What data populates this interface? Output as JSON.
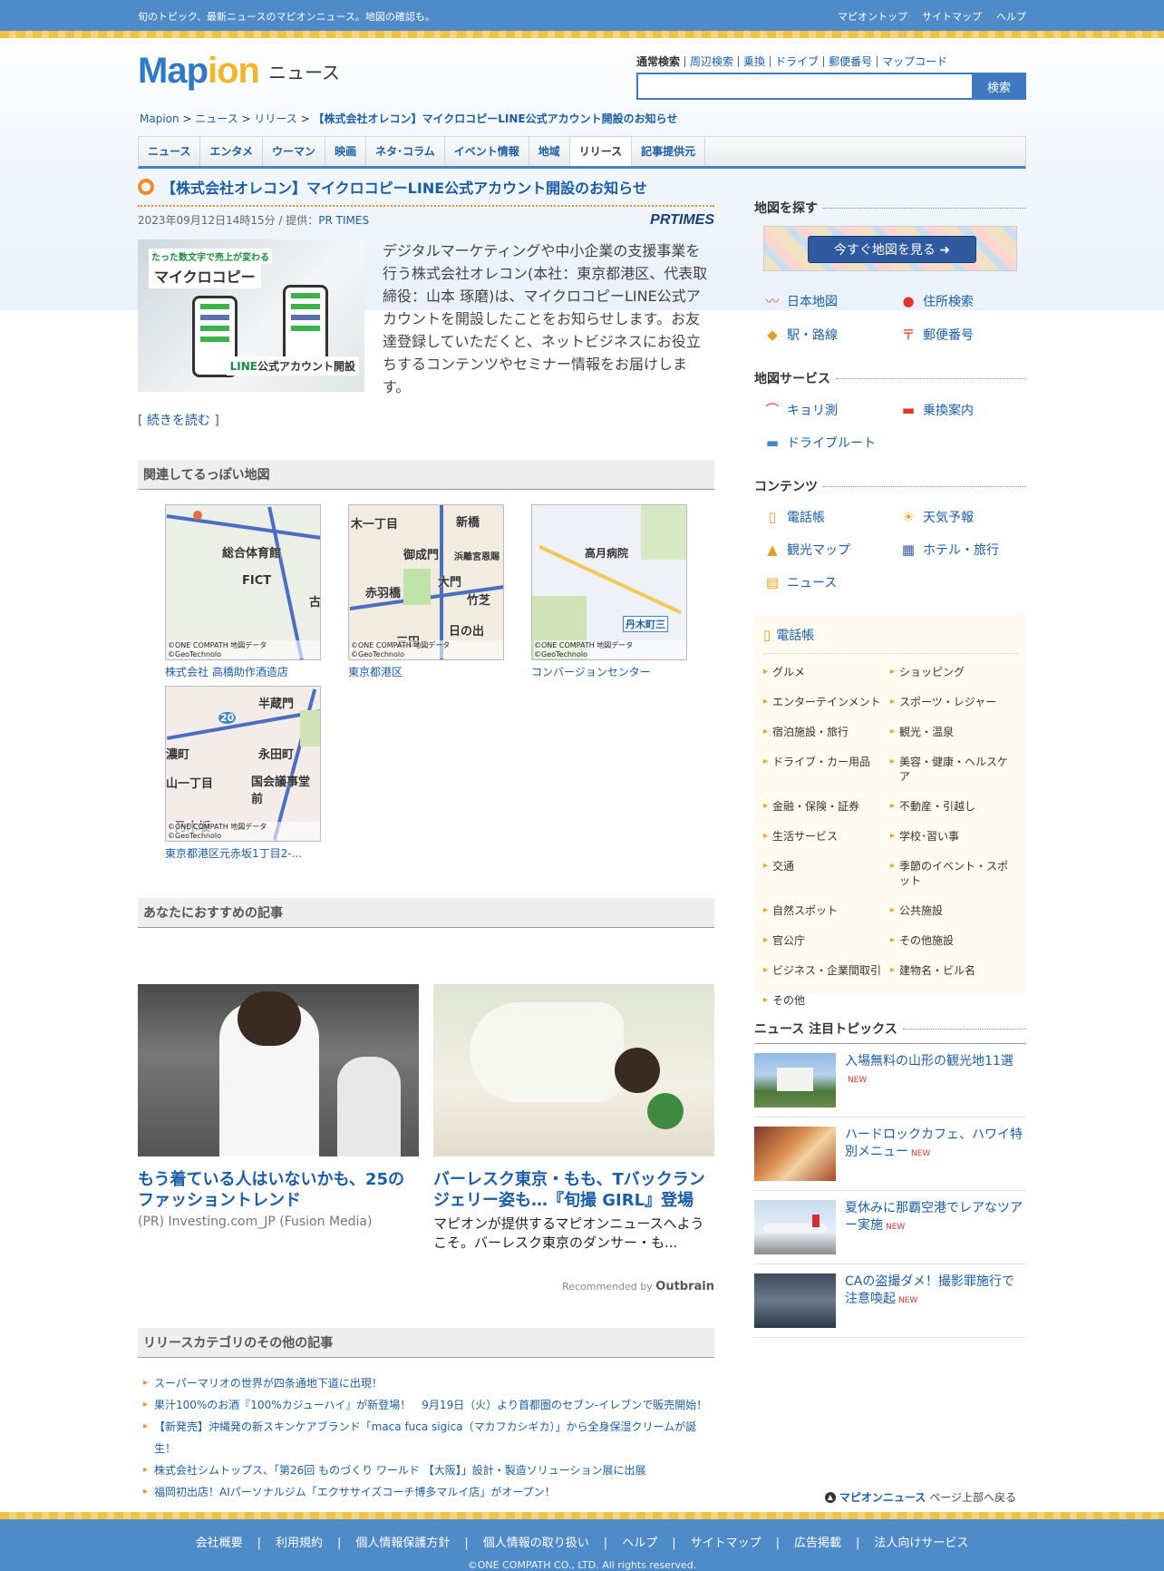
{
  "topbar": {
    "tagline": "旬のトピック、最新ニュースのマピオンニュース。地図の確認も。",
    "links": [
      "マピオントップ",
      "サイトマップ",
      "ヘルプ"
    ]
  },
  "logo": {
    "word_main": "Map",
    "word_rest": "ion",
    "sub": "ニュース"
  },
  "search": {
    "tabs": [
      "通常検索",
      "周辺検索",
      "乗換",
      "ドライブ",
      "郵便番号",
      "マップコード"
    ],
    "button": "検索",
    "value": ""
  },
  "breadcrumb": {
    "items": [
      "Mapion",
      "ニュース",
      "リリース"
    ],
    "current": "【株式会社オレコン】マイクロコピーLINE公式アカウント開設のお知らせ"
  },
  "nav": {
    "tabs": [
      "ニュース",
      "エンタメ",
      "ウーマン",
      "映画",
      "ネタ･コラム",
      "イベント情報",
      "地域",
      "リリース",
      "記事提供元"
    ],
    "active": "リリース"
  },
  "article": {
    "title": "【株式会社オレコン】マイクロコピーLINE公式アカウント開設のお知らせ",
    "meta": "2023年09月12日14時15分 / 提供：",
    "provider": "PR TIMES",
    "provider_logo": "PRTIMES",
    "thumb": {
      "t1": "たった数文字で売上が変わる",
      "t2": "マイクロコピー",
      "t3_green": "LINE",
      "t3_rest": "公式アカウント開設"
    },
    "body": "デジタルマーケティングや中小企業の支援事業を行う株式会社オレコン(本社：東京都港区、代表取締役：山本 琢磨)は、マイクロコピーLINE公式アカウントを開設したことをお知らせします。お友達登録していただくと、ネットビジネスにお役立ちするコンテンツやセミナー情報をお届けします。",
    "more": "続きを読む"
  },
  "maps_section": {
    "heading": "関連してるっぽい地図",
    "credit": "©ONE COMPATH 地図データ©GeoTechnolo",
    "items": [
      {
        "caption": "株式会社 高橋助作酒造店",
        "labels": [
          "総合体育館",
          "FICT",
          "古"
        ]
      },
      {
        "caption": "東京都港区",
        "labels": [
          "木一丁目",
          "新橋",
          "御成門",
          "大門",
          "赤羽橋",
          "竹芝",
          "三田",
          "日の出",
          "浜離宮恩賜"
        ]
      },
      {
        "caption": "コンバージョンセンター",
        "labels": [
          "高月病院",
          "丹木町三"
        ]
      },
      {
        "caption": "東京都港区元赤坂1丁目2-...",
        "labels": [
          "半蔵門",
          "永田町",
          "濃町",
          "山一丁目",
          "国会議事堂前",
          "乃木坂",
          "20"
        ]
      }
    ]
  },
  "recommend": {
    "heading": "あなたにおすすめの記事",
    "items": [
      {
        "title": "もう着ている人はいないかも、25のファッショントレンド",
        "source": "(PR) Investing.com_JP (Fusion Media)"
      },
      {
        "title": "バーレスク東京・もも、Tバックランジェリー姿も…『旬撮 GIRL』登場",
        "desc": "マピオンが提供するマピオンニュースへようこそ。バーレスク東京のダンサー・も..."
      }
    ],
    "outbrain_prefix": "Recommended by",
    "outbrain": "Outbrain"
  },
  "others": {
    "heading": "リリースカテゴリのその他の記事",
    "items": [
      "スーパーマリオの世界が四条通地下道に出現！",
      "果汁100%のお酒『100%カジューハイ』が新登場！　9月19日（火）より首都圏のセブン-イレブンで販売開始！",
      "【新発売】沖縄発の新スキンケアブランド「maca fuca sigica（マカフカシギカ）」から全身保湿クリームが誕生！",
      "株式会社シムトップス、「第26回 ものづくり ワールド 【大阪】」設計・製造ソリューション展に出展",
      "福岡初出店！AIパーソナルジム「エクササイズコーチ博多マルイ店」がオープン！"
    ]
  },
  "sidebar": {
    "find_heading": "地図を探す",
    "banner": "今すぐ地図を見る",
    "find_items": [
      {
        "icon": "map-icon",
        "glyph": "〰",
        "label": "日本地図",
        "color": "#e05a5a"
      },
      {
        "icon": "pin-icon",
        "glyph": "📍",
        "label": "住所検索",
        "color": "#e0362b"
      },
      {
        "icon": "train-icon",
        "glyph": "🚉",
        "label": "駅・路線",
        "color": "#e0a020"
      },
      {
        "icon": "postbox-icon",
        "glyph": "〒",
        "label": "郵便番号",
        "color": "#e0362b"
      }
    ],
    "service_heading": "地図サービス",
    "service_items": [
      {
        "icon": "ruler-icon",
        "glyph": "📏",
        "label": "キョリ測",
        "color": "#e0362b"
      },
      {
        "icon": "transit-icon",
        "glyph": "🚌",
        "label": "乗換案内",
        "color": "#e0362b"
      },
      {
        "icon": "car-icon",
        "glyph": "🚗",
        "label": "ドライブルート",
        "color": "#3f86c9"
      }
    ],
    "content_heading": "コンテンツ",
    "content_items": [
      {
        "icon": "phonebook-icon",
        "glyph": "📒",
        "label": "電話帳",
        "color": "#e0a020"
      },
      {
        "icon": "sun-icon",
        "glyph": "☀",
        "label": "天気予報",
        "color": "#f2a020"
      },
      {
        "icon": "tourist-icon",
        "glyph": "🚶",
        "label": "観光マップ",
        "color": "#e0a020"
      },
      {
        "icon": "hotel-icon",
        "glyph": "🏢",
        "label": "ホテル・旅行",
        "color": "#3f5aa0"
      },
      {
        "icon": "news-icon",
        "glyph": "📰",
        "label": "ニュース",
        "color": "#f2a020"
      }
    ],
    "directory_heading": "電話帳",
    "directory": [
      "グルメ",
      "ショッピング",
      "エンターテインメント",
      "スポーツ・レジャー",
      "宿泊施設・旅行",
      "観光・温泉",
      "ドライブ・カー用品",
      "美容・健康・ヘルスケア",
      "金融・保険・証券",
      "不動産・引越し",
      "生活サービス",
      "学校･習い事",
      "交通",
      "季節のイベント・スポット",
      "自然スポット",
      "公共施設",
      "官公庁",
      "その他施設",
      "ビジネス・企業間取引",
      "建物名・ビル名",
      "その他"
    ],
    "topics_heading": "ニュース 注目トピックス",
    "topics": [
      {
        "title": "入場無料の山形の観光地11選",
        "badge": "NEW"
      },
      {
        "title": "ハードロックカフェ、ハワイ特別メニュー",
        "badge": "NEW"
      },
      {
        "title": "夏休みに那覇空港でレアなツアー実施",
        "badge": "NEW"
      },
      {
        "title": "CAの盗撮ダメ！撮影罪施行で注意喚起",
        "badge": "NEW"
      }
    ]
  },
  "pagetop": {
    "brand": "マピオンニュース",
    "text": "ページ上部へ戻る"
  },
  "footer": {
    "links": [
      "会社概要",
      "利用規約",
      "個人情報保護方針",
      "個人情報の取り扱い",
      "ヘルプ",
      "サイトマップ",
      "広告掲載",
      "法人向けサービス"
    ],
    "copy": "©ONE COMPATH CO., LTD. All rights reserved."
  },
  "colors": {
    "brand_blue": "#4f8ac9",
    "link": "#1a5ea8",
    "accent_orange": "#f28c28"
  }
}
